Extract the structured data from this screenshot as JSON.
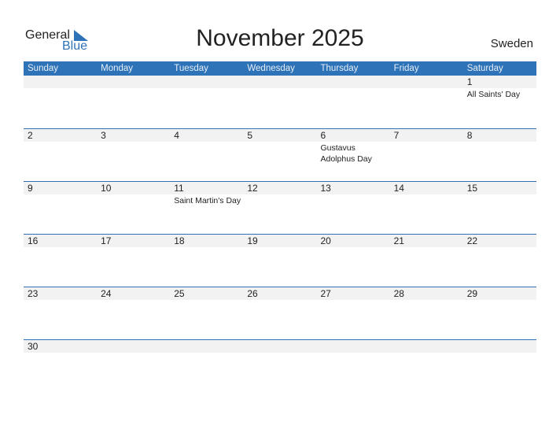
{
  "logo": {
    "word1": "General",
    "word2": "Blue"
  },
  "title": "November 2025",
  "country": "Sweden",
  "colors": {
    "accent": "#2e73b8",
    "band": "#f2f2f2"
  },
  "weekdays": [
    "Sunday",
    "Monday",
    "Tuesday",
    "Wednesday",
    "Thursday",
    "Friday",
    "Saturday"
  ],
  "weeks": [
    [
      {
        "day": ""
      },
      {
        "day": ""
      },
      {
        "day": ""
      },
      {
        "day": ""
      },
      {
        "day": ""
      },
      {
        "day": ""
      },
      {
        "day": "1",
        "holiday": "All Saints' Day"
      }
    ],
    [
      {
        "day": "2"
      },
      {
        "day": "3"
      },
      {
        "day": "4"
      },
      {
        "day": "5"
      },
      {
        "day": "6",
        "holiday": "Gustavus Adolphus Day"
      },
      {
        "day": "7"
      },
      {
        "day": "8"
      }
    ],
    [
      {
        "day": "9"
      },
      {
        "day": "10"
      },
      {
        "day": "11",
        "holiday": "Saint Martin's Day"
      },
      {
        "day": "12"
      },
      {
        "day": "13"
      },
      {
        "day": "14"
      },
      {
        "day": "15"
      }
    ],
    [
      {
        "day": "16"
      },
      {
        "day": "17"
      },
      {
        "day": "18"
      },
      {
        "day": "19"
      },
      {
        "day": "20"
      },
      {
        "day": "21"
      },
      {
        "day": "22"
      }
    ],
    [
      {
        "day": "23"
      },
      {
        "day": "24"
      },
      {
        "day": "25"
      },
      {
        "day": "26"
      },
      {
        "day": "27"
      },
      {
        "day": "28"
      },
      {
        "day": "29"
      }
    ],
    [
      {
        "day": "30"
      },
      {
        "day": ""
      },
      {
        "day": ""
      },
      {
        "day": ""
      },
      {
        "day": ""
      },
      {
        "day": ""
      },
      {
        "day": ""
      }
    ]
  ]
}
